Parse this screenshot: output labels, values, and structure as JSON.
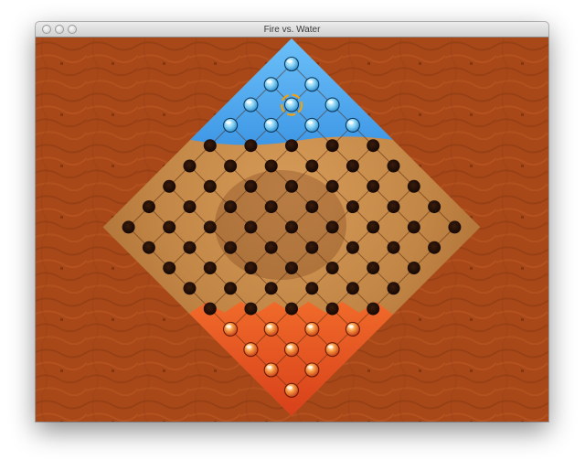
{
  "window": {
    "title": "Fire vs. Water"
  },
  "titlebar_buttons": [
    "close",
    "minimize",
    "zoom"
  ],
  "board": {
    "size": 9,
    "shape": "diamond",
    "water_camp": [
      [
        0,
        0
      ],
      [
        0,
        1
      ],
      [
        0,
        2
      ],
      [
        0,
        3
      ],
      [
        1,
        0
      ],
      [
        1,
        1
      ],
      [
        1,
        2
      ],
      [
        2,
        0
      ],
      [
        2,
        1
      ],
      [
        3,
        0
      ]
    ],
    "fire_camp": [
      [
        8,
        8
      ],
      [
        8,
        7
      ],
      [
        8,
        6
      ],
      [
        8,
        5
      ],
      [
        7,
        8
      ],
      [
        7,
        7
      ],
      [
        7,
        6
      ],
      [
        6,
        8
      ],
      [
        6,
        7
      ],
      [
        5,
        8
      ]
    ],
    "selected_piece": [
      1,
      1
    ]
  },
  "colors": {
    "background_wood": "#a84818",
    "board_wood": "#c48a4a",
    "water": "#5aaef0",
    "fire": "#e0451a",
    "hole": "#1e0e06",
    "water_piece": "#8ed6f6",
    "fire_piece": "#f08a3a",
    "selection": "#f0a010"
  },
  "pieces": {
    "water_name": "water-piece",
    "fire_name": "fire-piece"
  }
}
